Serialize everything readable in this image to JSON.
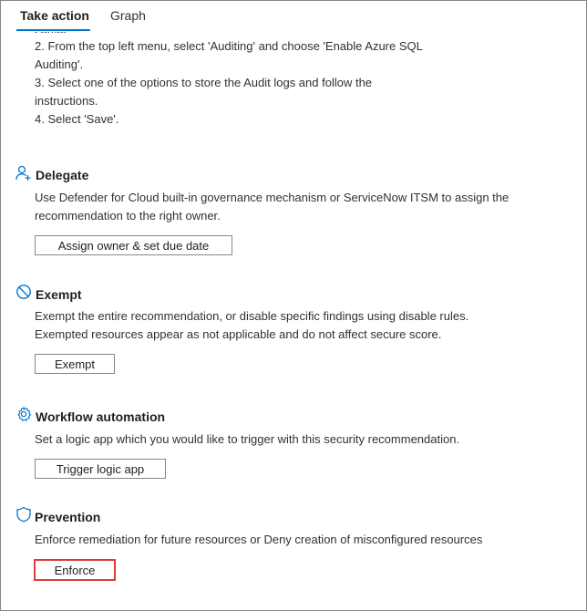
{
  "tabs": [
    {
      "label": "Take action"
    },
    {
      "label": "Graph"
    }
  ],
  "cut_text": "server.",
  "remediation_steps": [
    "2. From the top left menu, select 'Auditing' and choose 'Enable Azure SQL",
    "Auditing'.",
    "3. Select one of the options to store the Audit logs and follow the",
    "instructions.",
    "4. Select 'Save'."
  ],
  "delegate": {
    "title": "Delegate",
    "icon": "person-add-icon",
    "description_lines": [
      "Use Defender for Cloud built-in governance mechanism or ServiceNow ITSM to assign the",
      "recommendation to the right owner."
    ],
    "button_label": "Assign owner & set due date"
  },
  "exempt": {
    "title": "Exempt",
    "icon": "block-icon",
    "description_lines": [
      "Exempt the entire recommendation, or disable specific findings using disable rules.",
      "Exempted resources appear as not applicable and do not affect secure score."
    ],
    "button_label": "Exempt"
  },
  "workflow": {
    "title": "Workflow automation",
    "icon": "gear-icon",
    "description": "Set a logic app which you would like to trigger with this security recommendation.",
    "button_label": "Trigger logic app"
  },
  "prevention": {
    "title": "Prevention",
    "icon": "shield-icon",
    "description": "Enforce remediation for future resources or Deny creation of misconfigured resources",
    "button_label": "Enforce"
  },
  "colors": {
    "accent": "#0078d4",
    "highlight_border": "#e03a3a",
    "text": "#323130"
  }
}
